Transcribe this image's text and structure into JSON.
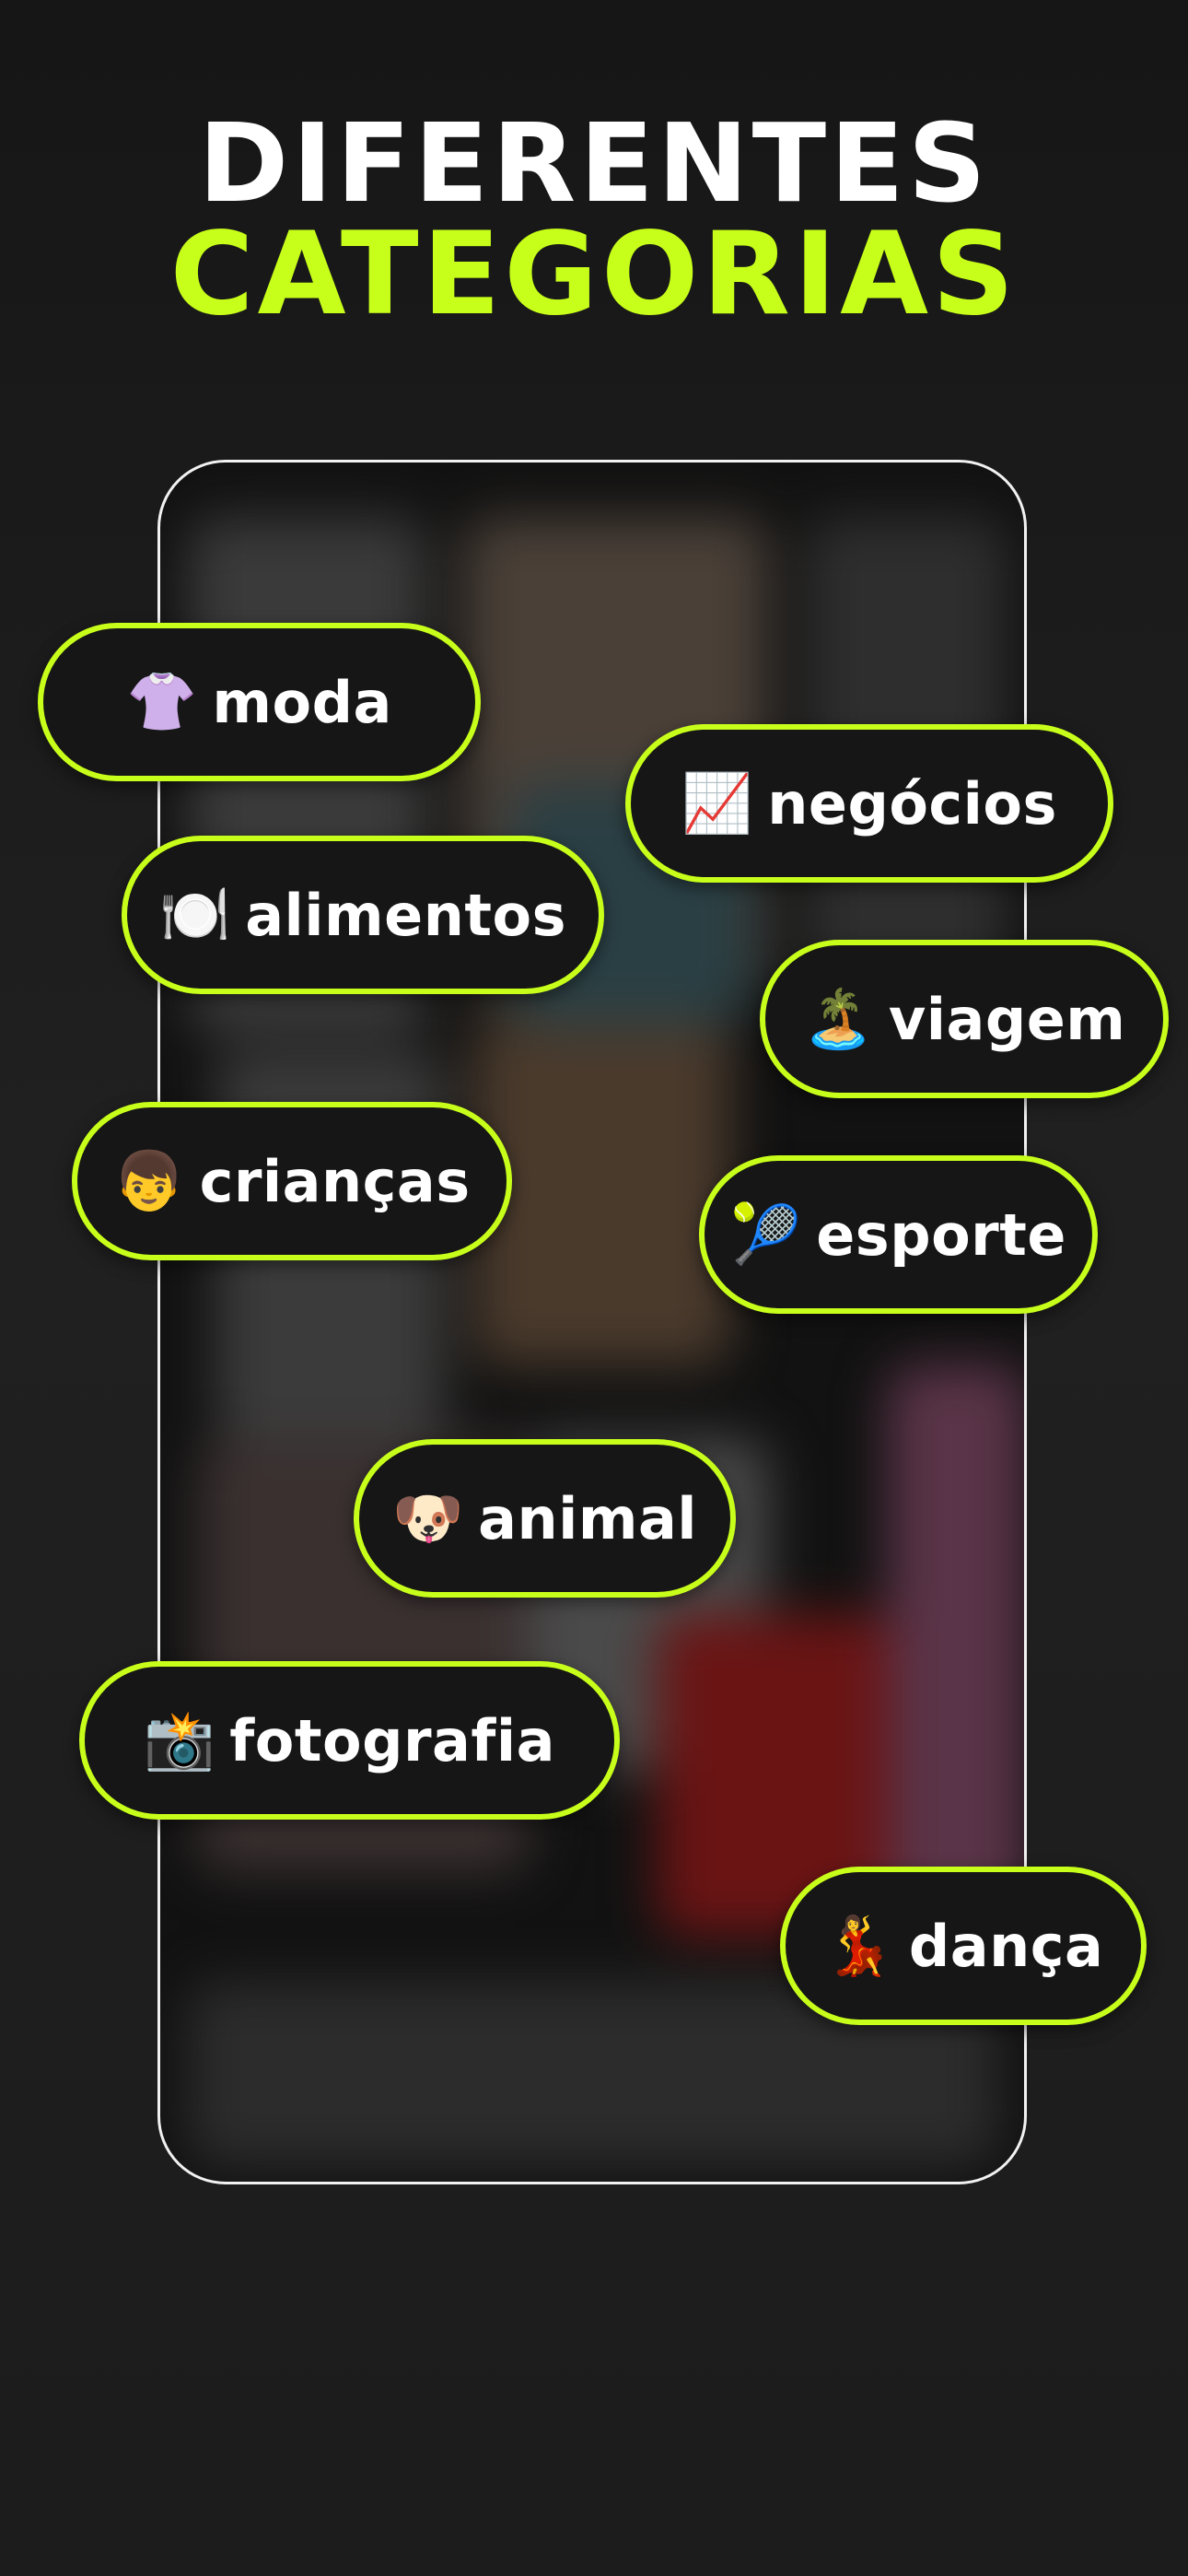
{
  "headline": {
    "line1": "DIFERENTES",
    "line2": "CATEGORIAS"
  },
  "colors": {
    "accent": "#c8ff1a",
    "background": "#1c1c1c",
    "chip_background": "#161616",
    "text": "#ffffff"
  },
  "categories": [
    {
      "emoji": "👚",
      "icon": "blouse-icon",
      "label": "moda"
    },
    {
      "emoji": "📈",
      "icon": "chart-increasing-icon",
      "label": "negócios"
    },
    {
      "emoji": "🍽️",
      "icon": "plate-icon",
      "label": "alimentos"
    },
    {
      "emoji": "🏝️",
      "icon": "beach-umbrella-icon",
      "label": "viagem"
    },
    {
      "emoji": "👦",
      "icon": "boy-icon",
      "label": "crianças"
    },
    {
      "emoji": "🎾",
      "icon": "tennis-ball-icon",
      "label": "esporte"
    },
    {
      "emoji": "🐶",
      "icon": "dog-face-icon",
      "label": "animal"
    },
    {
      "emoji": "📸",
      "icon": "camera-flash-icon",
      "label": "fotografia"
    },
    {
      "emoji": "💃",
      "icon": "dancer-icon",
      "label": "dança"
    }
  ]
}
